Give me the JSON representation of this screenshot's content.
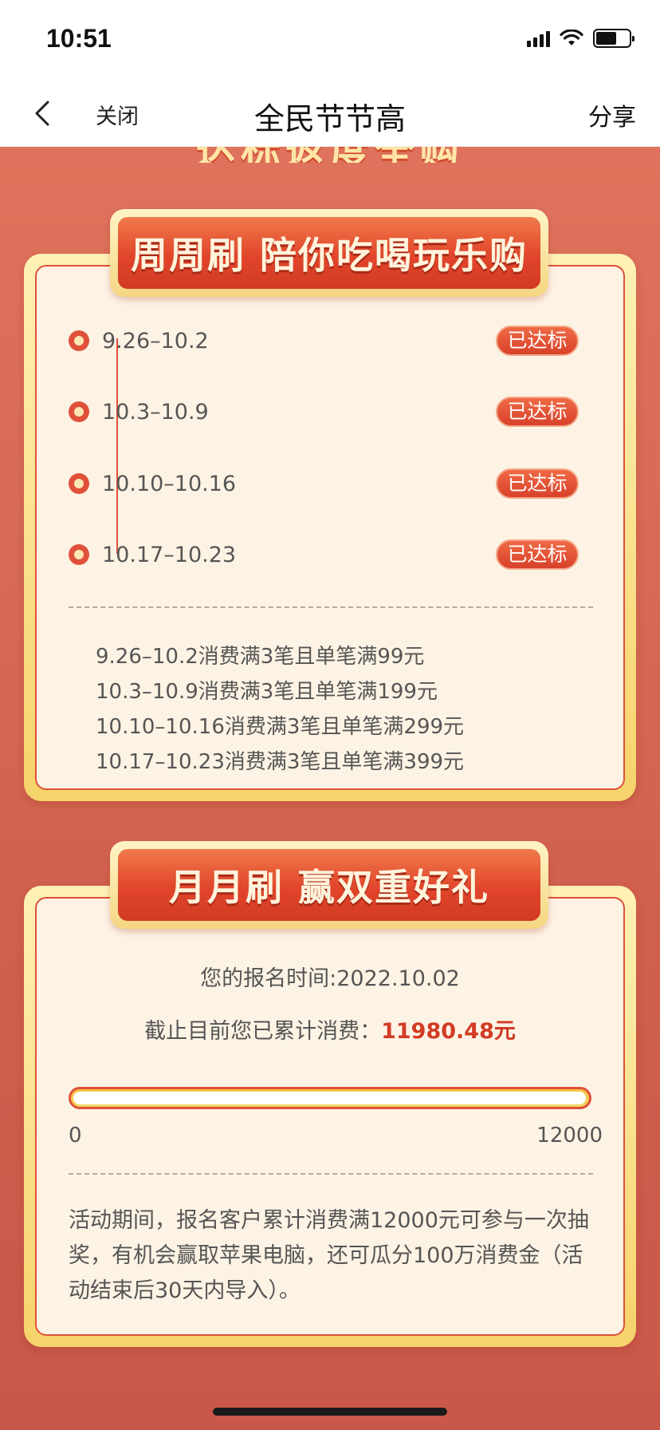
{
  "status": {
    "time": "10:51"
  },
  "nav": {
    "close": "关闭",
    "title": "全民节节高",
    "share": "分享"
  },
  "top_banner": {
    "text": "达标返度全购"
  },
  "weekly": {
    "ribbon": "周周刷 陪你吃喝玩乐购",
    "weeks": [
      {
        "range": "9.26–10.2",
        "status": "已达标"
      },
      {
        "range": "10.3–10.9",
        "status": "已达标"
      },
      {
        "range": "10.10–10.16",
        "status": "已达标"
      },
      {
        "range": "10.17–10.23",
        "status": "已达标"
      }
    ],
    "rules": [
      "9.26–10.2消费满3笔且单笔满99元",
      "10.3–10.9消费满3笔且单笔满199元",
      "10.10–10.16消费满3笔且单笔满299元",
      "10.17–10.23消费满3笔且单笔满399元"
    ]
  },
  "monthly": {
    "ribbon": "月月刷 赢双重好礼",
    "signup_label": "您的报名时间:",
    "signup_date": "2022.10.02",
    "spent_label": "截止目前您已累计消费：",
    "spent_amount": "11980.48元",
    "progress": {
      "min": "0",
      "max": "12000",
      "value": 11980.48,
      "fraction": 0.998
    },
    "description": "活动期间，报名客户累计消费满12000元可参与一次抽奖，有机会赢取苹果电脑，还可瓜分100万消费金（活动结束后30天内导入）。"
  },
  "colors": {
    "accent": "#e0503a",
    "amount": "#d23b24",
    "gold": "#f6c445"
  }
}
